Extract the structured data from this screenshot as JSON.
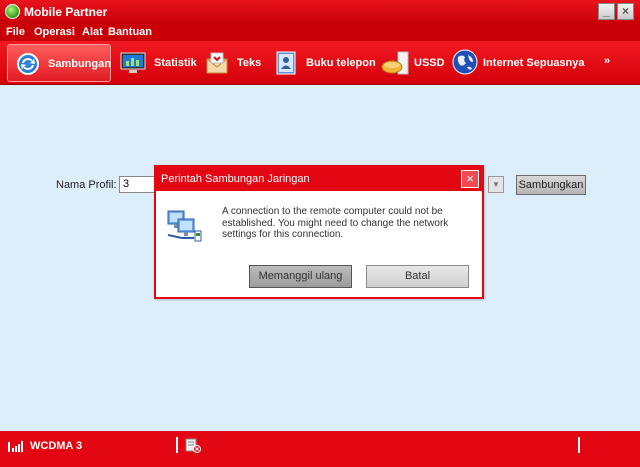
{
  "window": {
    "title": "Mobile Partner",
    "buttons": [
      "_",
      "×"
    ]
  },
  "menu": [
    "File",
    "Operasi",
    "Alat",
    "Bantuan"
  ],
  "toolbar": {
    "items": [
      {
        "label": "Sambungan",
        "icon": "connection-icon",
        "active": true
      },
      {
        "label": "Statistik",
        "icon": "statistics-monitor-icon"
      },
      {
        "label": "Teks",
        "icon": "envelope-icon"
      },
      {
        "label": "Buku telepon",
        "icon": "phonebook-icon"
      },
      {
        "label": "USSD",
        "icon": "ussd-icon"
      },
      {
        "label": "Internet Sepuasnya",
        "icon": "globe-icon"
      }
    ],
    "more": "»"
  },
  "connection": {
    "profile_label": "Nama Profil:",
    "profile_value": "3",
    "connect_button": "Sambungkan"
  },
  "dialog": {
    "title": "Perintah Sambungan Jaringan",
    "message": "A connection to the remote computer could not be established. You might need to change the network settings for this connection.",
    "retry_button": "Memanggil ulang",
    "cancel_button": "Batal",
    "close": "×"
  },
  "status": {
    "network": "WCDMA  3"
  },
  "colors": {
    "brand_red": "#e30613",
    "background": "#dbeef9"
  }
}
